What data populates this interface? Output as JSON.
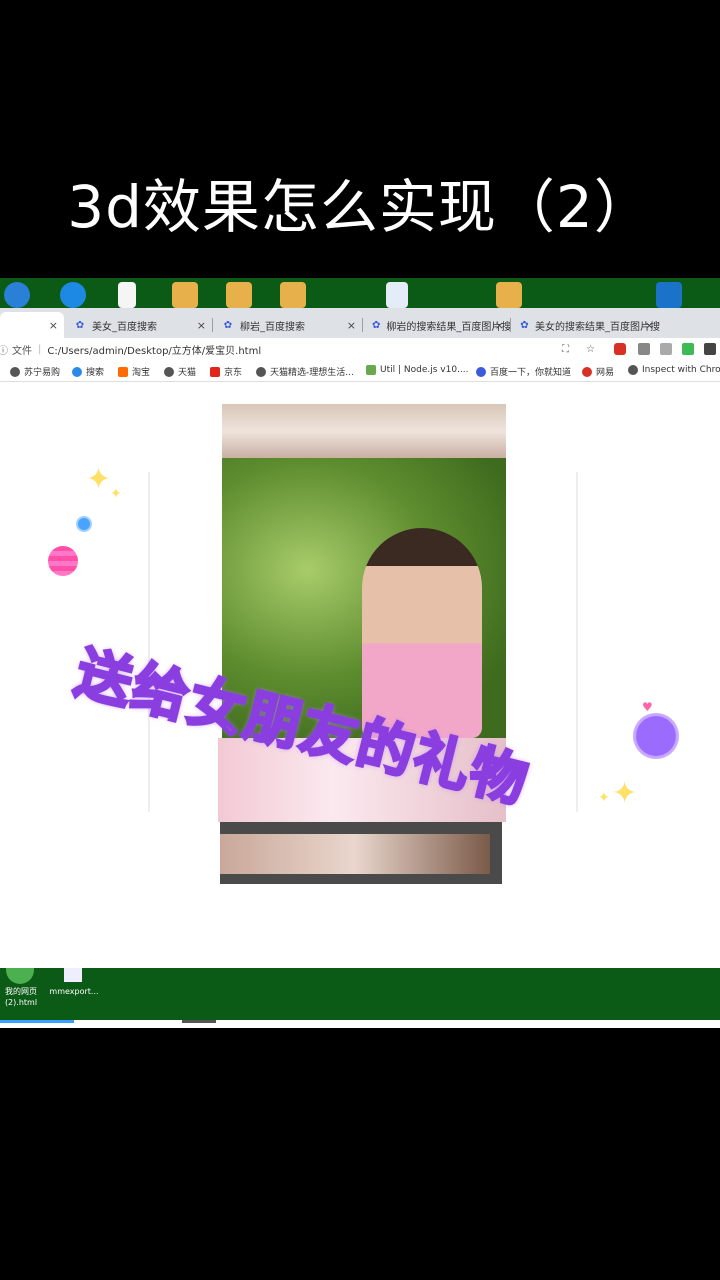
{
  "video": {
    "title": "3d效果怎么实现（2）"
  },
  "overlay": {
    "caption": "送给女朋友的礼物"
  },
  "browser": {
    "tabs": [
      {
        "label": "",
        "active": true
      },
      {
        "label": "美女_百度搜索"
      },
      {
        "label": "柳岩_百度搜索"
      },
      {
        "label": "柳岩的搜索结果_百度图片搜"
      },
      {
        "label": "美女的搜索结果_百度图片搜"
      }
    ],
    "close_glyph": "×",
    "new_tab_glyph": "+",
    "address": {
      "scheme_label": "文件",
      "url": "C:/Users/admin/Desktop/立方体/爱宝贝.html"
    },
    "bookmarks": [
      {
        "label": "苏宁易购"
      },
      {
        "label": "搜索"
      },
      {
        "label": "淘宝"
      },
      {
        "label": "天猫"
      },
      {
        "label": "京东"
      },
      {
        "label": "天猫精选-理想生活..."
      },
      {
        "label": "Util | Node.js v10...."
      },
      {
        "label": "百度一下，你就知道"
      },
      {
        "label": "网易"
      },
      {
        "label": "Inspect with Chro..."
      }
    ]
  },
  "taskbar": {
    "items": [
      {
        "label": "我的网页\n(2).html"
      },
      {
        "label": "mmexport..."
      }
    ]
  },
  "colors": {
    "desktop": "#0b5a16",
    "sticker_fill": "#ffe14d",
    "sticker_stroke": "#8a3ee0"
  }
}
